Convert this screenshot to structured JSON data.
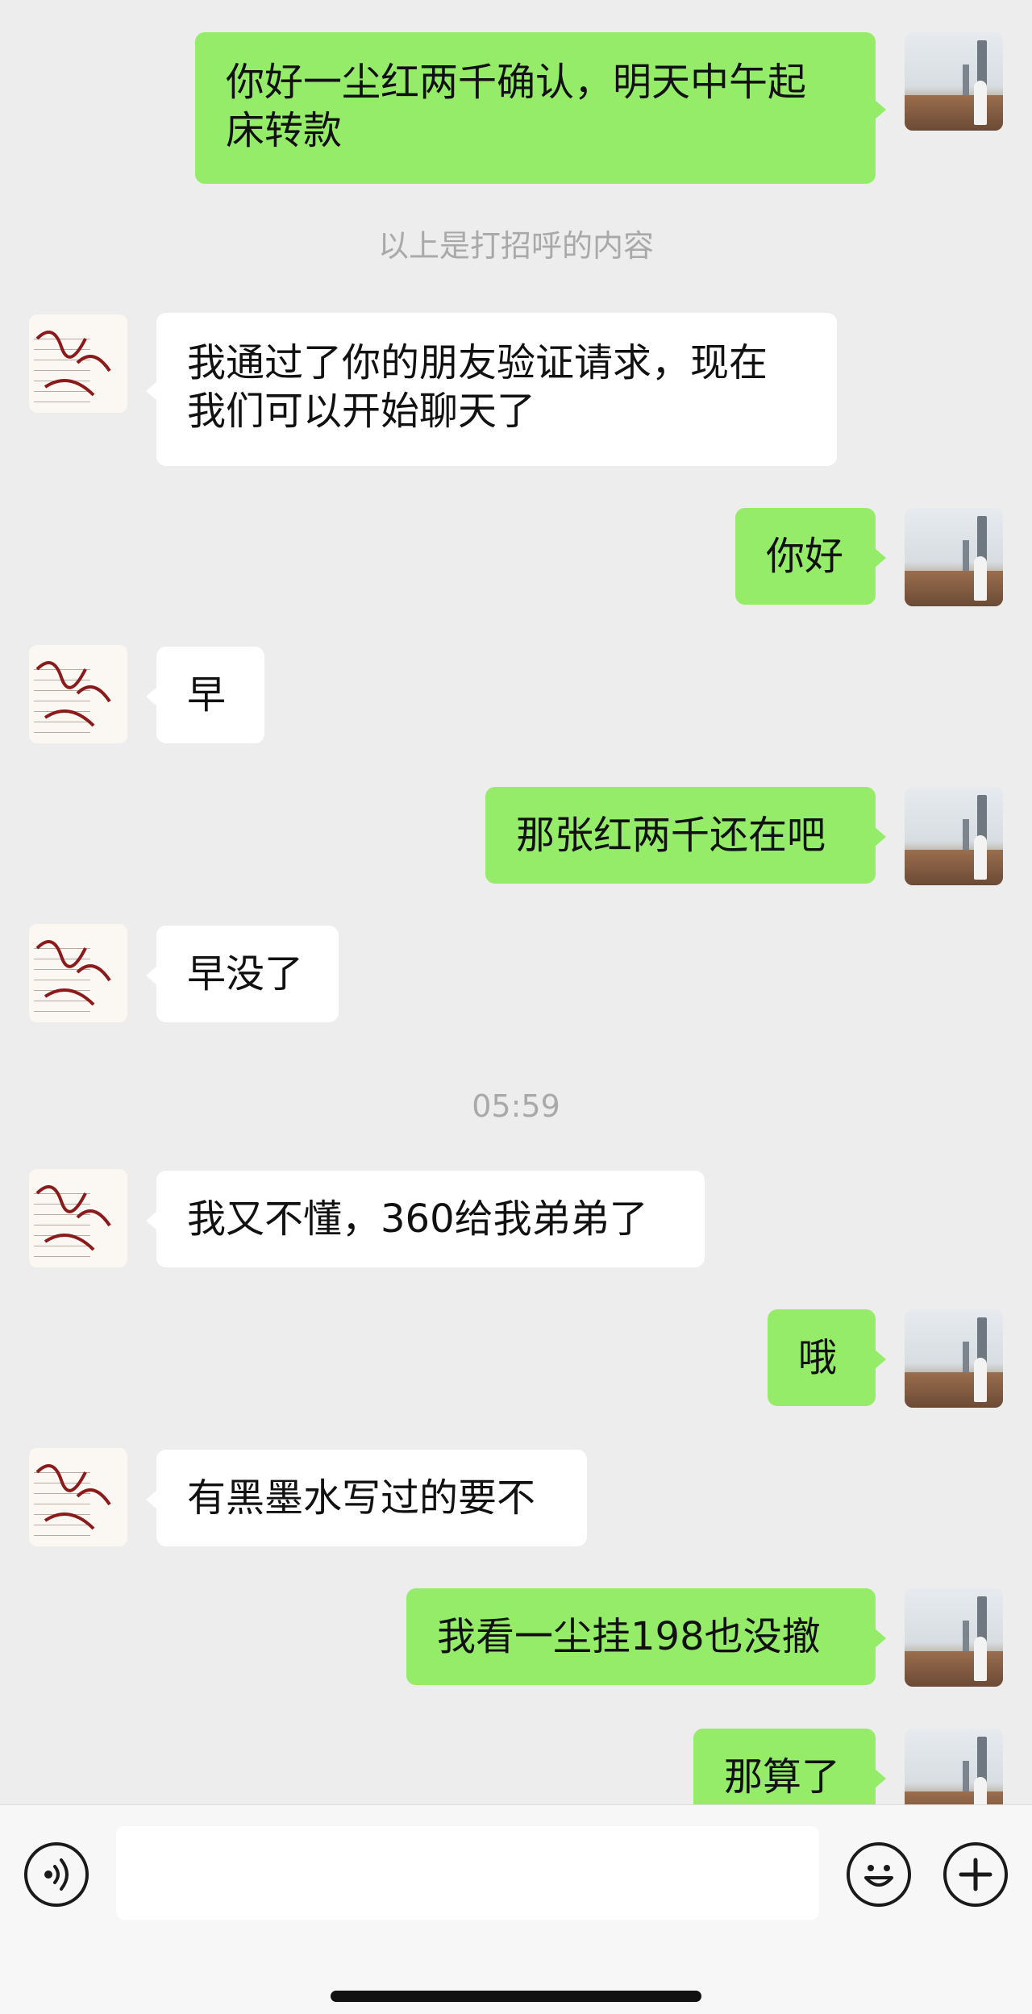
{
  "messages": [
    {
      "text": "你好一尘红两千确认，明天中午起床转款",
      "line1": "你好一尘红两千确认，明天中午起",
      "line2": "床转款",
      "sender": "self"
    },
    {
      "system": "以上是打招呼的内容"
    },
    {
      "line1": "我通过了你的朋友验证请求，现在",
      "line2": "我们可以开始聊天了",
      "sender": "other"
    },
    {
      "text": "你好",
      "sender": "self"
    },
    {
      "text": "早",
      "sender": "other"
    },
    {
      "text": "那张红两千还在吧",
      "sender": "self"
    },
    {
      "text": "早没了",
      "sender": "other"
    },
    {
      "system": "05:59"
    },
    {
      "text": "我又不懂，360给我弟弟了",
      "sender": "other"
    },
    {
      "text": "哦",
      "sender": "self"
    },
    {
      "text": "有黑墨水写过的要不",
      "sender": "other"
    },
    {
      "text": "我看一尘挂198也没撤",
      "sender": "self"
    },
    {
      "text": "那算了",
      "sender": "self"
    }
  ],
  "input": {
    "value": ""
  },
  "icons": {
    "voice": "voice-icon",
    "emoji": "emoji-icon",
    "more": "plus-icon"
  },
  "colors": {
    "self_bubble": "#95ec69",
    "other_bubble": "#ffffff",
    "background": "#ededed"
  }
}
